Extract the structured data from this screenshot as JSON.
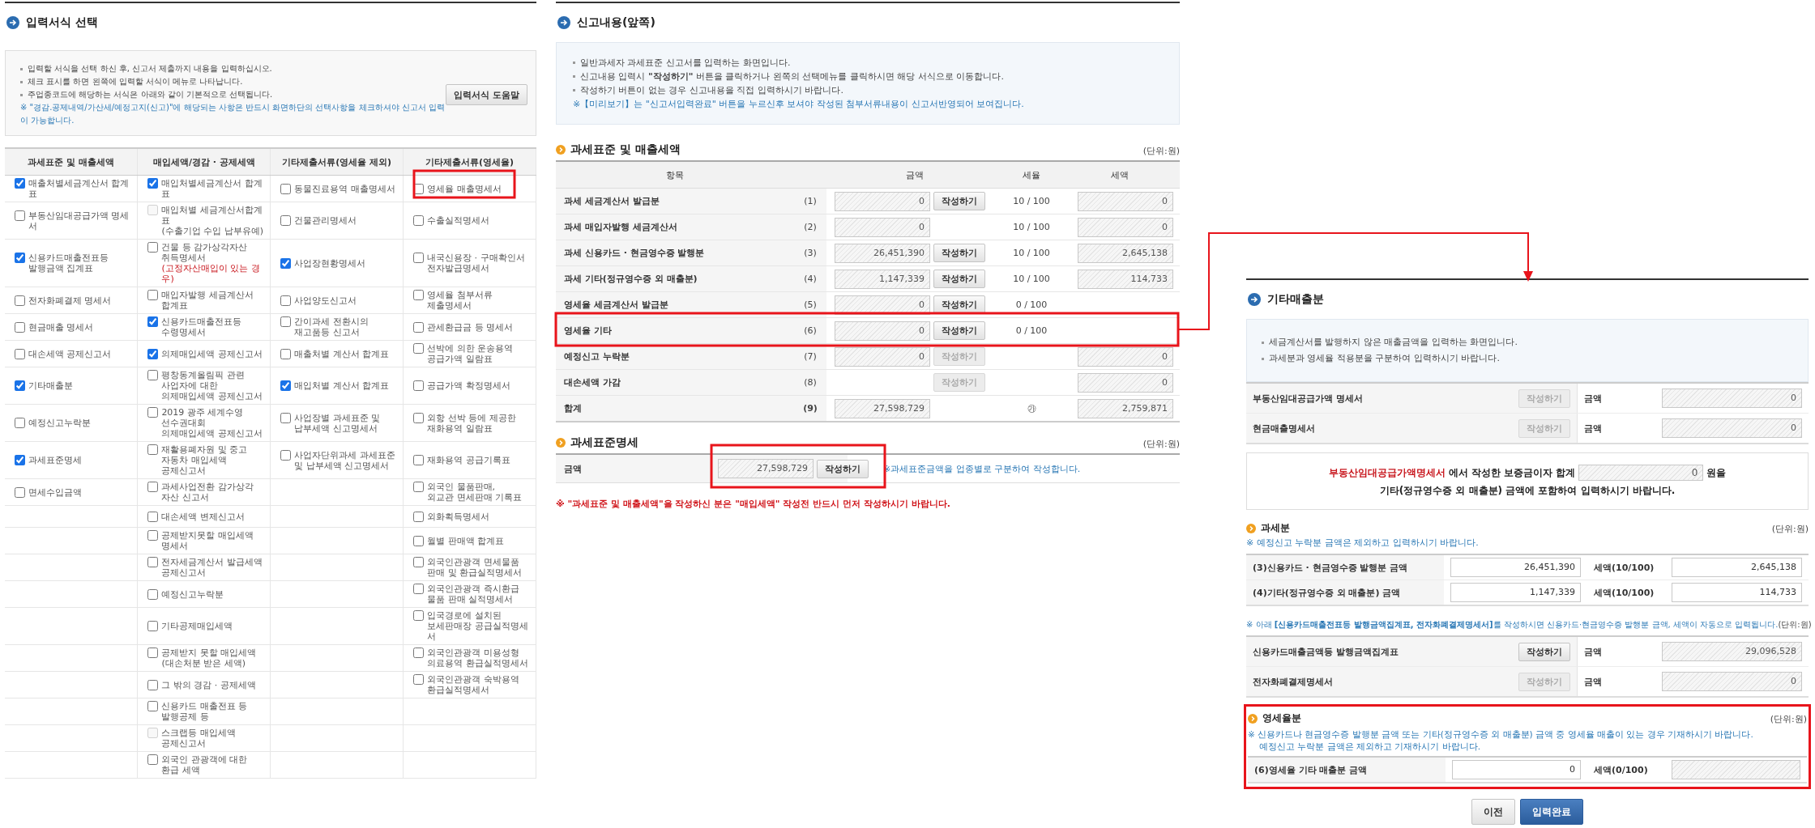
{
  "left": {
    "title": "입력서식 선택",
    "info": [
      "입력할 서식을 선택 하신 후, 신고서 제출까지 내용을 입력하십시오.",
      "체크 표시를 하면 왼쪽에 입력할 서식이 메뉴로 나타납니다.",
      "주업종코드에 해당하는 서식은 아래와 같이 기본적으로 선택됩니다."
    ],
    "notice": "※ \"경감.공제내역/가산세/예정고지(신고)\"에 해당되는 사항은 반드시 화면하단의 선택사항을 체크하셔야 신고서 입력이 가능합니다.",
    "help_button": "입력서식 도움말",
    "columns": [
      "과세표준 및 매출세액",
      "매입세액/경감 · 공제세액",
      "기타제출서류(영세율 제외)",
      "기타제출서류(영세율)"
    ],
    "rows": [
      {
        "cells": [
          {
            "label": "매출처별세금계산서 합계표",
            "checked": true,
            "disabled": false
          },
          {
            "label": "매입처별세금계산서 합계표",
            "checked": true,
            "disabled": false
          },
          {
            "label": "동물진료용역 매출명세서",
            "checked": false,
            "disabled": false
          },
          {
            "label": "영세율 매출명세서",
            "checked": false,
            "disabled": false
          }
        ]
      },
      {
        "cells": [
          {
            "label": "부동산임대공급가액 명세서",
            "checked": false,
            "disabled": false
          },
          {
            "label": "매입처별 세금계산서합계표\n(수출기업 수입 납부유예)",
            "checked": false,
            "disabled": true
          },
          {
            "label": "건물관리명세서",
            "checked": false,
            "disabled": false
          },
          {
            "label": "수출실적명세서",
            "checked": false,
            "disabled": false
          }
        ]
      },
      {
        "cells": [
          {
            "label": "신용카드매출전표등\n발행금액 집계표",
            "checked": true,
            "disabled": false
          },
          {
            "label": "건물 등 감가상각자산\n취득명세서",
            "note": "(고정자산매입이 있는 경우)",
            "checked": false,
            "disabled": false
          },
          {
            "label": "사업장현황명세서",
            "checked": true,
            "disabled": false
          },
          {
            "label": "내국신용장 · 구매확인서\n전자발급명세서",
            "checked": false,
            "disabled": false
          }
        ]
      },
      {
        "cells": [
          {
            "label": "전자화폐결제 명세서",
            "checked": false,
            "disabled": false
          },
          {
            "label": "매입자발행 세금계산서\n합계표",
            "checked": false,
            "disabled": false
          },
          {
            "label": "사업양도신고서",
            "checked": false,
            "disabled": false
          },
          {
            "label": "영세율 첨부서류\n제출명세서",
            "checked": false,
            "disabled": false
          }
        ]
      },
      {
        "cells": [
          {
            "label": "현금매출 명세서",
            "checked": false,
            "disabled": false
          },
          {
            "label": "신용카드매출전표등\n수령명세서",
            "checked": true,
            "disabled": false
          },
          {
            "label": "간이과세 전환시의\n재고품등 신고서",
            "checked": false,
            "disabled": false
          },
          {
            "label": "관세환급금 등 명세서",
            "checked": false,
            "disabled": false
          }
        ]
      },
      {
        "cells": [
          {
            "label": "대손세액 공제신고서",
            "checked": false,
            "disabled": false
          },
          {
            "label": "의제매입세액 공제신고서",
            "checked": true,
            "disabled": false
          },
          {
            "label": "매출처별 계산서 합계표",
            "checked": false,
            "disabled": false
          },
          {
            "label": "선박에 의한 운송용역\n공급가액 일람표",
            "checked": false,
            "disabled": false
          }
        ]
      },
      {
        "cells": [
          {
            "label": "기타매출분",
            "checked": true,
            "disabled": false
          },
          {
            "label": "평창동계올림픽 관련\n사업자에 대한\n의제매입세액 공제신고서",
            "checked": false,
            "disabled": false
          },
          {
            "label": "매입처별 계산서 합계표",
            "checked": true,
            "disabled": false
          },
          {
            "label": "공급가액 확정명세서",
            "checked": false,
            "disabled": false
          }
        ]
      },
      {
        "cells": [
          {
            "label": "예정신고누락분",
            "checked": false,
            "disabled": false
          },
          {
            "label": "2019 광주 세계수영\n선수권대회\n의제매입세액 공제신고서",
            "checked": false,
            "disabled": false
          },
          {
            "label": "사업장별 과세표준 및\n납부세액 신고명세서",
            "checked": false,
            "disabled": false
          },
          {
            "label": "외항 선박 등에 제공한\n재화용역 일람표",
            "checked": false,
            "disabled": false
          }
        ]
      },
      {
        "cells": [
          {
            "label": "과세표준명세",
            "checked": true,
            "disabled": false
          },
          {
            "label": "재활용폐자원 및 중고\n자동차 매입세액\n공제신고서",
            "checked": false,
            "disabled": false
          },
          {
            "label": "사업자단위과세 과세표준\n및 납부세액 신고명세서",
            "checked": false,
            "disabled": false
          },
          {
            "label": "재화용역 공급기록표",
            "checked": false,
            "disabled": false
          }
        ]
      },
      {
        "cells": [
          {
            "label": "면세수입금액",
            "checked": false,
            "disabled": false
          },
          {
            "label": "과세사업전환 감가상각\n자산 신고서",
            "checked": false,
            "disabled": false
          },
          null,
          {
            "label": "외국인 물품판매,\n외교관 면세판매 기록표",
            "checked": false,
            "disabled": false
          }
        ]
      },
      {
        "cells": [
          null,
          {
            "label": "대손세액 변제신고서",
            "checked": false,
            "disabled": false
          },
          null,
          {
            "label": "외화획득명세서",
            "checked": false,
            "disabled": false
          }
        ]
      },
      {
        "cells": [
          null,
          {
            "label": "공제받지못할 매입세액\n명세서",
            "checked": false,
            "disabled": false
          },
          null,
          {
            "label": "월별 판매액 합계표",
            "checked": false,
            "disabled": false
          }
        ]
      },
      {
        "cells": [
          null,
          {
            "label": "전자세금계산서 발급세액\n공제신고서",
            "checked": false,
            "disabled": false
          },
          null,
          {
            "label": "외국인관광객 면세물품\n판매 및 환급실적명세서",
            "checked": false,
            "disabled": false
          }
        ]
      },
      {
        "cells": [
          null,
          {
            "label": "예정신고누락분",
            "checked": false,
            "disabled": false
          },
          null,
          {
            "label": "외국인관광객 즉시환급\n물품 판매 실적명세서",
            "checked": false,
            "disabled": false
          }
        ]
      },
      {
        "cells": [
          null,
          {
            "label": "기타공제매입세액",
            "checked": false,
            "disabled": false
          },
          null,
          {
            "label": "입국경로에 설치된\n보세판매장 공급실적명세서",
            "checked": false,
            "disabled": false
          }
        ]
      },
      {
        "cells": [
          null,
          {
            "label": "공제받지 못할 매입세액\n(대손처분 받은 세액)",
            "checked": false,
            "disabled": false
          },
          null,
          {
            "label": "외국인관광객 미용성형\n의료용역 환급실적명세서",
            "checked": false,
            "disabled": false
          }
        ]
      },
      {
        "cells": [
          null,
          {
            "label": "그 밖의 경감 · 공제세액",
            "checked": false,
            "disabled": false
          },
          null,
          {
            "label": "외국인관광객 숙박용역\n환급실적명세서",
            "checked": false,
            "disabled": false
          }
        ]
      },
      {
        "cells": [
          null,
          {
            "label": "신용카드 매출전표 등\n발행공제 등",
            "checked": false,
            "disabled": false
          },
          null,
          null
        ]
      },
      {
        "cells": [
          null,
          {
            "label": "스크랩등 매입세액\n공제신고서",
            "checked": false,
            "disabled": true
          },
          null,
          null
        ]
      },
      {
        "cells": [
          null,
          {
            "label": "외국인 관광객에 대한\n환급 세액",
            "checked": false,
            "disabled": false
          },
          null,
          null
        ]
      }
    ]
  },
  "middle": {
    "title": "신고내용(앞쪽)",
    "info": [
      "일반과세자 과세표준 신고서를 입력하는 화면입니다.",
      "신고내용 입력시 **\"작성하기\"** 버튼을 클릭하거나 왼쪽의 선택메뉴를 클릭하시면 해당 서식으로 이동합니다.",
      "작성하기 버튼이 없는 경우 신고내용을 직접 입력하시기 바랍니다."
    ],
    "notice": "※【미리보기】는 \"신고서입력완료\" 버튼을 누르신후 보셔야 작성된 첨부서류내용이 신고서반영되어 보여집니다.",
    "section": {
      "title": "과세표준 및 매출세액",
      "unit": "(단위:원)",
      "columns": [
        "항목",
        "금액",
        "세율",
        "세액"
      ],
      "rows": [
        {
          "kind": "item",
          "label": "과세 세금계산서 발급분",
          "no": "(1)",
          "amount": {
            "value": "0",
            "readonly": true
          },
          "button": {
            "label": "작성하기",
            "disabled": false
          },
          "rate": "10 / 100",
          "tax": {
            "value": "0",
            "readonly": true
          }
        },
        {
          "kind": "item",
          "label": "과세 매입자발행 세금계산서",
          "no": "(2)",
          "amount": {
            "value": "0",
            "readonly": true
          },
          "rate": "10 / 100",
          "tax": {
            "value": "0",
            "readonly": true
          }
        },
        {
          "kind": "item",
          "label": "과세 신용카드 · 현금영수증 발행분",
          "no": "(3)",
          "amount": {
            "value": "26,451,390",
            "readonly": true
          },
          "button": {
            "label": "작성하기",
            "disabled": false
          },
          "rate": "10 / 100",
          "tax": {
            "value": "2,645,138",
            "readonly": true
          }
        },
        {
          "kind": "item",
          "label": "과세 기타(정규영수증 외 매출분)",
          "no": "(4)",
          "amount": {
            "value": "1,147,339",
            "readonly": true
          },
          "button": {
            "label": "작성하기",
            "disabled": false
          },
          "rate": "10 / 100",
          "tax": {
            "value": "114,733",
            "readonly": true
          }
        },
        {
          "kind": "item",
          "label": "영세율 세금계산서 발급분",
          "no": "(5)",
          "amount": {
            "value": "0",
            "readonly": true
          },
          "button": {
            "label": "작성하기",
            "disabled": false
          },
          "rate": "0 / 100"
        },
        {
          "kind": "item",
          "label": "영세율 기타",
          "no": "(6)",
          "amount": {
            "value": "0",
            "readonly": true
          },
          "button": {
            "label": "작성하기",
            "disabled": false
          },
          "rate": "0 / 100"
        },
        {
          "kind": "item",
          "label": "예정신고 누락분",
          "no": "(7)",
          "amount": {
            "value": "0",
            "readonly": true
          },
          "button": {
            "label": "작성하기",
            "disabled": true
          },
          "tax": {
            "value": "0",
            "readonly": true
          }
        },
        {
          "kind": "item",
          "label": "대손세액 가감",
          "no": "(8)",
          "button": {
            "label": "작성하기",
            "disabled": true
          },
          "tax": {
            "value": "0",
            "readonly": true
          }
        },
        {
          "kind": "total",
          "label": "합계",
          "no": "(9)",
          "amount": {
            "value": "27,598,729",
            "readonly": true
          },
          "rate": "㉮",
          "tax": {
            "value": "2,759,871",
            "readonly": true
          }
        }
      ]
    },
    "tax_base": {
      "title": "과세표준명세",
      "unit": "(단위:원)",
      "label": "금액",
      "amount": {
        "value": "27,598,729",
        "readonly": true
      },
      "button": {
        "label": "작성하기",
        "disabled": false
      },
      "note": "※과세표준금액을 업종별로 구분하여 작성합니다."
    },
    "warning": "※ \"과세표준 및 매출세액\"을 작성하신 분은 \"매입세액\" 작성전 반드시 먼저 작성하시기 바랍니다."
  },
  "right": {
    "title": "기타매출분",
    "info": [
      "세금계산서를 발행하지 않은 매출금액을 입력하는 화면입니다.",
      "과세분과 영세율 적용분을 구분하여 입력하시기 바랍니다."
    ],
    "forms": [
      {
        "label": "부동산임대공급가액 명세서",
        "button": {
          "label": "작성하기",
          "disabled": true
        },
        "amount_label": "금액",
        "amount": {
          "value": "0",
          "readonly": true
        }
      },
      {
        "label": "현금매출명세서",
        "button": {
          "label": "작성하기",
          "disabled": true
        },
        "amount_label": "금액",
        "amount": {
          "value": "0",
          "readonly": true
        }
      }
    ],
    "notice": {
      "form_name": "부동산임대공급가액명세서",
      "text": "에서 작성한 보증금이자 합계",
      "value": "0",
      "unit": "원을",
      "line2": "기타(정규영수증 외 매출분) 금액에 포함하여 입력하시기 바랍니다."
    },
    "taxable": {
      "title": "과세분",
      "unit": "(단위:원)",
      "note": "※ 예정신고 누락분 금액은 제외하고 입력하시기 바랍니다.",
      "rows": [
        {
          "label": "(3)신용카드 · 현금영수증 발행분 금액",
          "amount": {
            "value": "26,451,390",
            "readonly": false
          },
          "tax_label": "세액(10/100)",
          "tax": {
            "value": "2,645,138",
            "readonly": false
          }
        },
        {
          "label": "(4)기타(정규영수증 외 매출분) 금액",
          "amount": {
            "value": "1,147,339",
            "readonly": false
          },
          "tax_label": "세액(10/100)",
          "tax": {
            "value": "114,733",
            "readonly": false
          }
        }
      ]
    },
    "auto_note": "※ 아래 **[신용카드매출전표등 발행금액집계표, 전자화폐결제명세서]**를 작성하시면 신용카드·현금영수증 발행분 금액, 세액이 자동으로 입력됩니다.",
    "auto_unit": "(단위:원)",
    "auto_forms": [
      {
        "label": "신용카드매출금액등 발행금액집계표",
        "button": {
          "label": "작성하기",
          "disabled": false
        },
        "amount_label": "금액",
        "amount": {
          "value": "29,096,528",
          "readonly": true
        }
      },
      {
        "label": "전자화폐결제명세서",
        "button": {
          "label": "작성하기",
          "disabled": true
        },
        "amount_label": "금액",
        "amount": {
          "value": "0",
          "readonly": true
        }
      }
    ],
    "zero_rate": {
      "title": "영세율분",
      "unit": "(단위:원)",
      "notes": [
        "※ 신용카드나 현금영수증 발행분 금액 또는 기타(정규영수증 외 매출분) 금액 중 영세율 매출이 있는 경우 기재하시기 바랍니다.",
        "예정신고 누락분 금액은 제외하고 기재하시기 바랍니다."
      ],
      "rows": [
        {
          "label": "(6)영세율 기타 매출분 금액",
          "amount": {
            "value": "0",
            "readonly": false
          },
          "tax_label": "세액(0/100)",
          "tax": {
            "readonly": true
          }
        }
      ]
    },
    "buttons": [
      {
        "label": "이전",
        "kind": "secondary"
      },
      {
        "label": "입력완료",
        "kind": "primary"
      }
    ]
  }
}
